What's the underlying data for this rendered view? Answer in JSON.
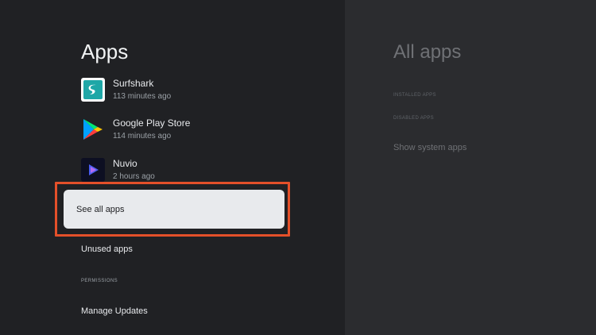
{
  "left": {
    "title": "Apps",
    "apps": [
      {
        "name": "Surfshark",
        "time": "113 minutes ago",
        "icon": "surfshark-icon"
      },
      {
        "name": "Google Play Store",
        "time": "114 minutes ago",
        "icon": "google-play-store-icon"
      },
      {
        "name": "Nuvio",
        "time": "2 hours ago",
        "icon": "nuvio-icon"
      }
    ],
    "see_all_label": "See all apps",
    "unused_label": "Unused apps",
    "permissions_header": "PERMISSIONS",
    "manage_updates_label": "Manage Updates"
  },
  "right": {
    "title": "All apps",
    "installed_header": "INSTALLED APPS",
    "disabled_header": "DISABLED APPS",
    "show_system_label": "Show system apps"
  },
  "colors": {
    "background": "#202124",
    "right_panel": "#2b2c2f",
    "focus_outline": "#e4502a",
    "selected_item": "#e8eaed",
    "surfshark_brand": "#1ea7a7"
  }
}
